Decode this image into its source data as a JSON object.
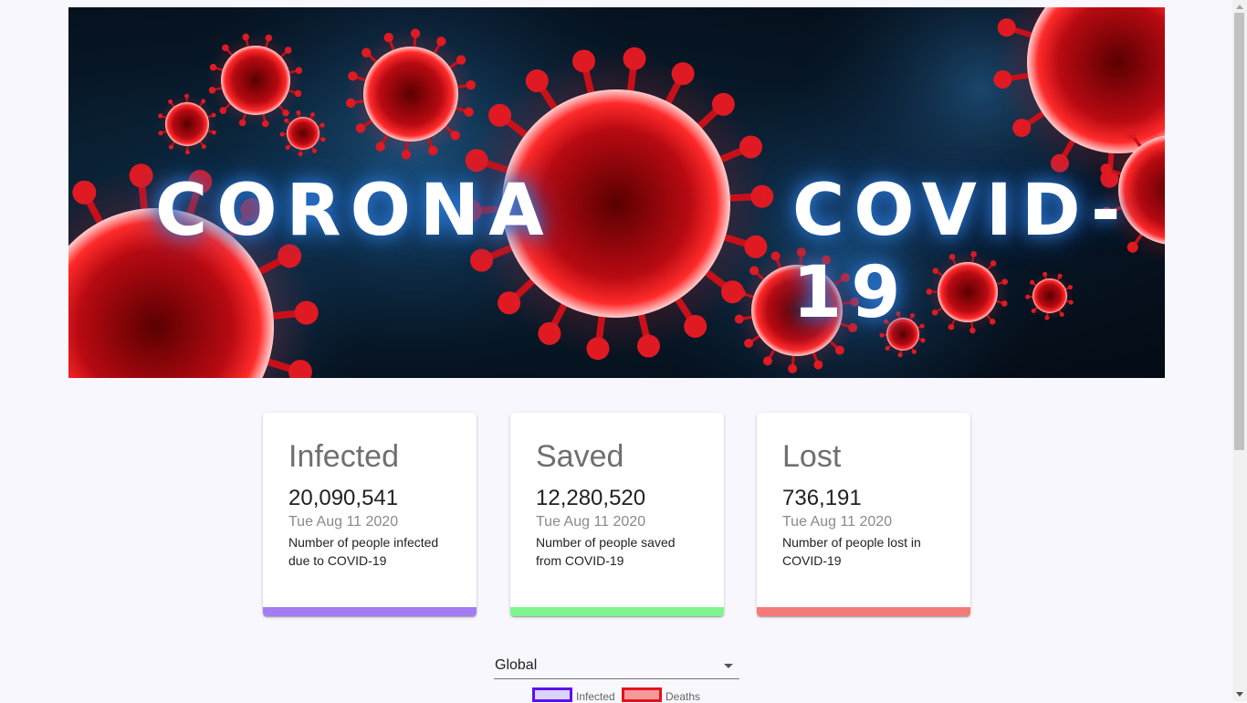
{
  "banner": {
    "left_word": "CORONA",
    "right_word": "COVID-19",
    "virus_color": "#d4101a",
    "background_color": "#071625"
  },
  "cards": {
    "infected": {
      "title": "Infected",
      "count": "20,090,541",
      "date": "Tue Aug 11 2020",
      "description": "Number of people infected due to COVID-19",
      "accent": "#a47cf4"
    },
    "saved": {
      "title": "Saved",
      "count": "12,280,520",
      "date": "Tue Aug 11 2020",
      "description": "Number of people saved from COVID-19",
      "accent": "#7ef58d"
    },
    "lost": {
      "title": "Lost",
      "count": "736,191",
      "date": "Tue Aug 11 2020",
      "description": "Number of people lost in COVID-19",
      "accent": "#f47a7a"
    }
  },
  "country_select": {
    "selected": "Global"
  },
  "legend": {
    "infected": {
      "label": "Infected",
      "border": "#5b10f0",
      "fill": "#d9d3f5"
    },
    "deaths": {
      "label": "Deaths",
      "border": "#e8101a",
      "fill": "#f49a9a"
    }
  }
}
